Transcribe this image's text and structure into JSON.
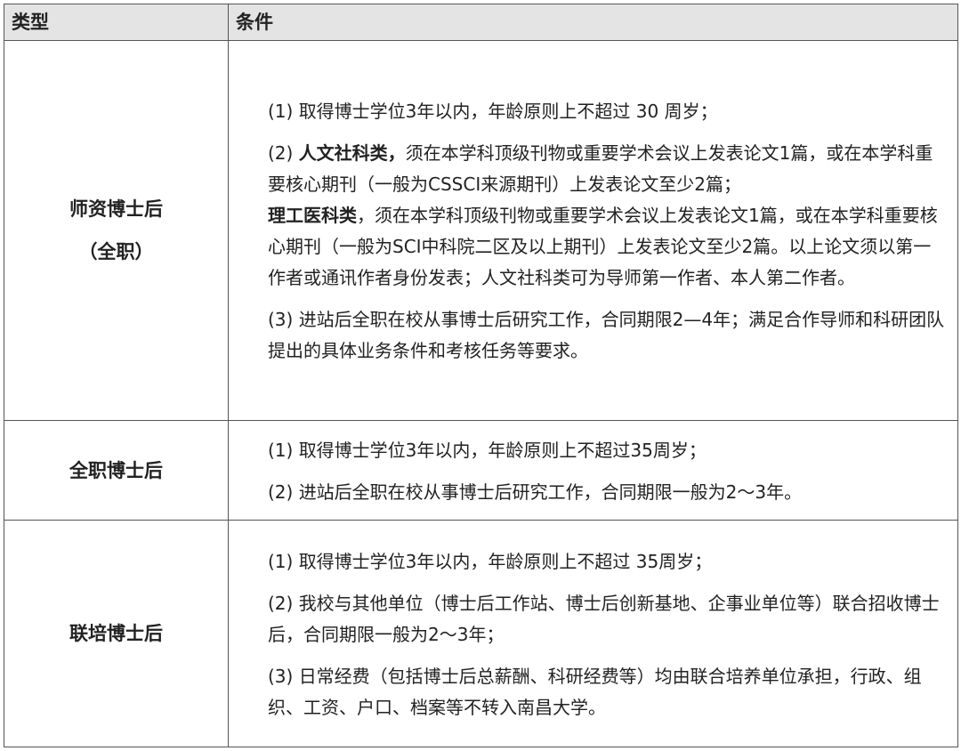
{
  "header": {
    "col_type": "类型",
    "col_condition": "条件"
  },
  "rows": [
    {
      "type_line1": "师资博士后",
      "type_line2": "（全职）",
      "p1": "(1) 取得博士学位3年以内，年龄原则上不超过 30 周岁；",
      "p2_a_label": "人文社科类，",
      "p2_a_prefix": "(2) ",
      "p2_a_text": "须在本学科顶级刊物或重要学术会议上发表论文1篇，或在本学科重要核心期刊（一般为CSSCI来源期刊）上发表论文至少2篇；",
      "p2_b_label": "理工医科类",
      "p2_b_text": "，须在本学科顶级刊物或重要学术会议上发表论文1篇，或在本学科重要核心期刊（一般为SCI中科院二区及以上期刊）上发表论文至少2篇。以上论文须以第一作者或通讯作者身份发表；人文社科类可为导师第一作者、本人第二作者。",
      "p3": "(3) 进站后全职在校从事博士后研究工作，合同期限2—4年；满足合作导师和科研团队提出的具体业务条件和考核任务等要求。"
    },
    {
      "type": "全职博士后",
      "p1": "(1) 取得博士学位3年以内，年龄原则上不超过35周岁；",
      "p2": "(2) 进站后全职在校从事博士后研究工作，合同期限一般为2～3年。"
    },
    {
      "type": "联培博士后",
      "p1": "(1) 取得博士学位3年以内，年龄原则上不超过 35周岁；",
      "p2": "(2) 我校与其他单位（博士后工作站、博士后创新基地、企事业单位等）联合招收博士后，合同期限一般为2～3年；",
      "p3": "(3) 日常经费（包括博士后总薪酬、科研经费等）均由联合培养单位承担，行政、组织、工资、户口、档案等不转入南昌大学。"
    }
  ]
}
